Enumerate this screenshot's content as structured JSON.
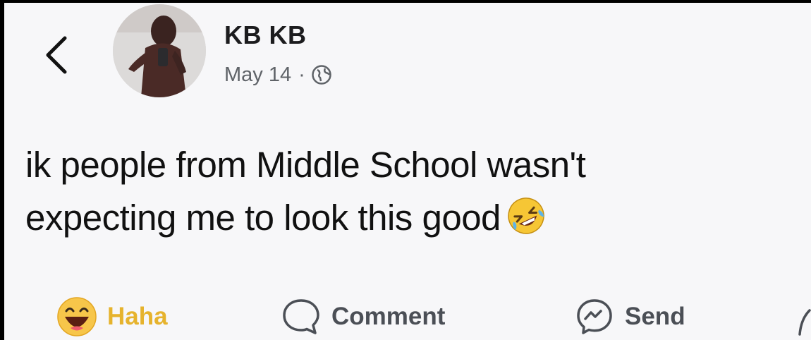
{
  "post": {
    "author": "KB KB",
    "date": "May 14",
    "separator": "·",
    "privacy_icon": "globe-icon",
    "text_line1": "ik people from Middle School wasn't",
    "text_line2": "expecting me to look this good",
    "inline_emoji": "rolling-on-the-floor-laughing-emoji"
  },
  "actions": {
    "haha_label": "Haha",
    "comment_label": "Comment",
    "send_label": "Send"
  },
  "icons": {
    "back": "chevron-left-icon",
    "haha": "haha-reaction-icon",
    "comment": "comment-bubble-icon",
    "send": "messenger-icon",
    "share": "share-icon"
  },
  "colors": {
    "background": "#f7f7f9",
    "haha_active": "#e6b32d",
    "text": "#111111",
    "secondary_text": "#5f6368"
  }
}
